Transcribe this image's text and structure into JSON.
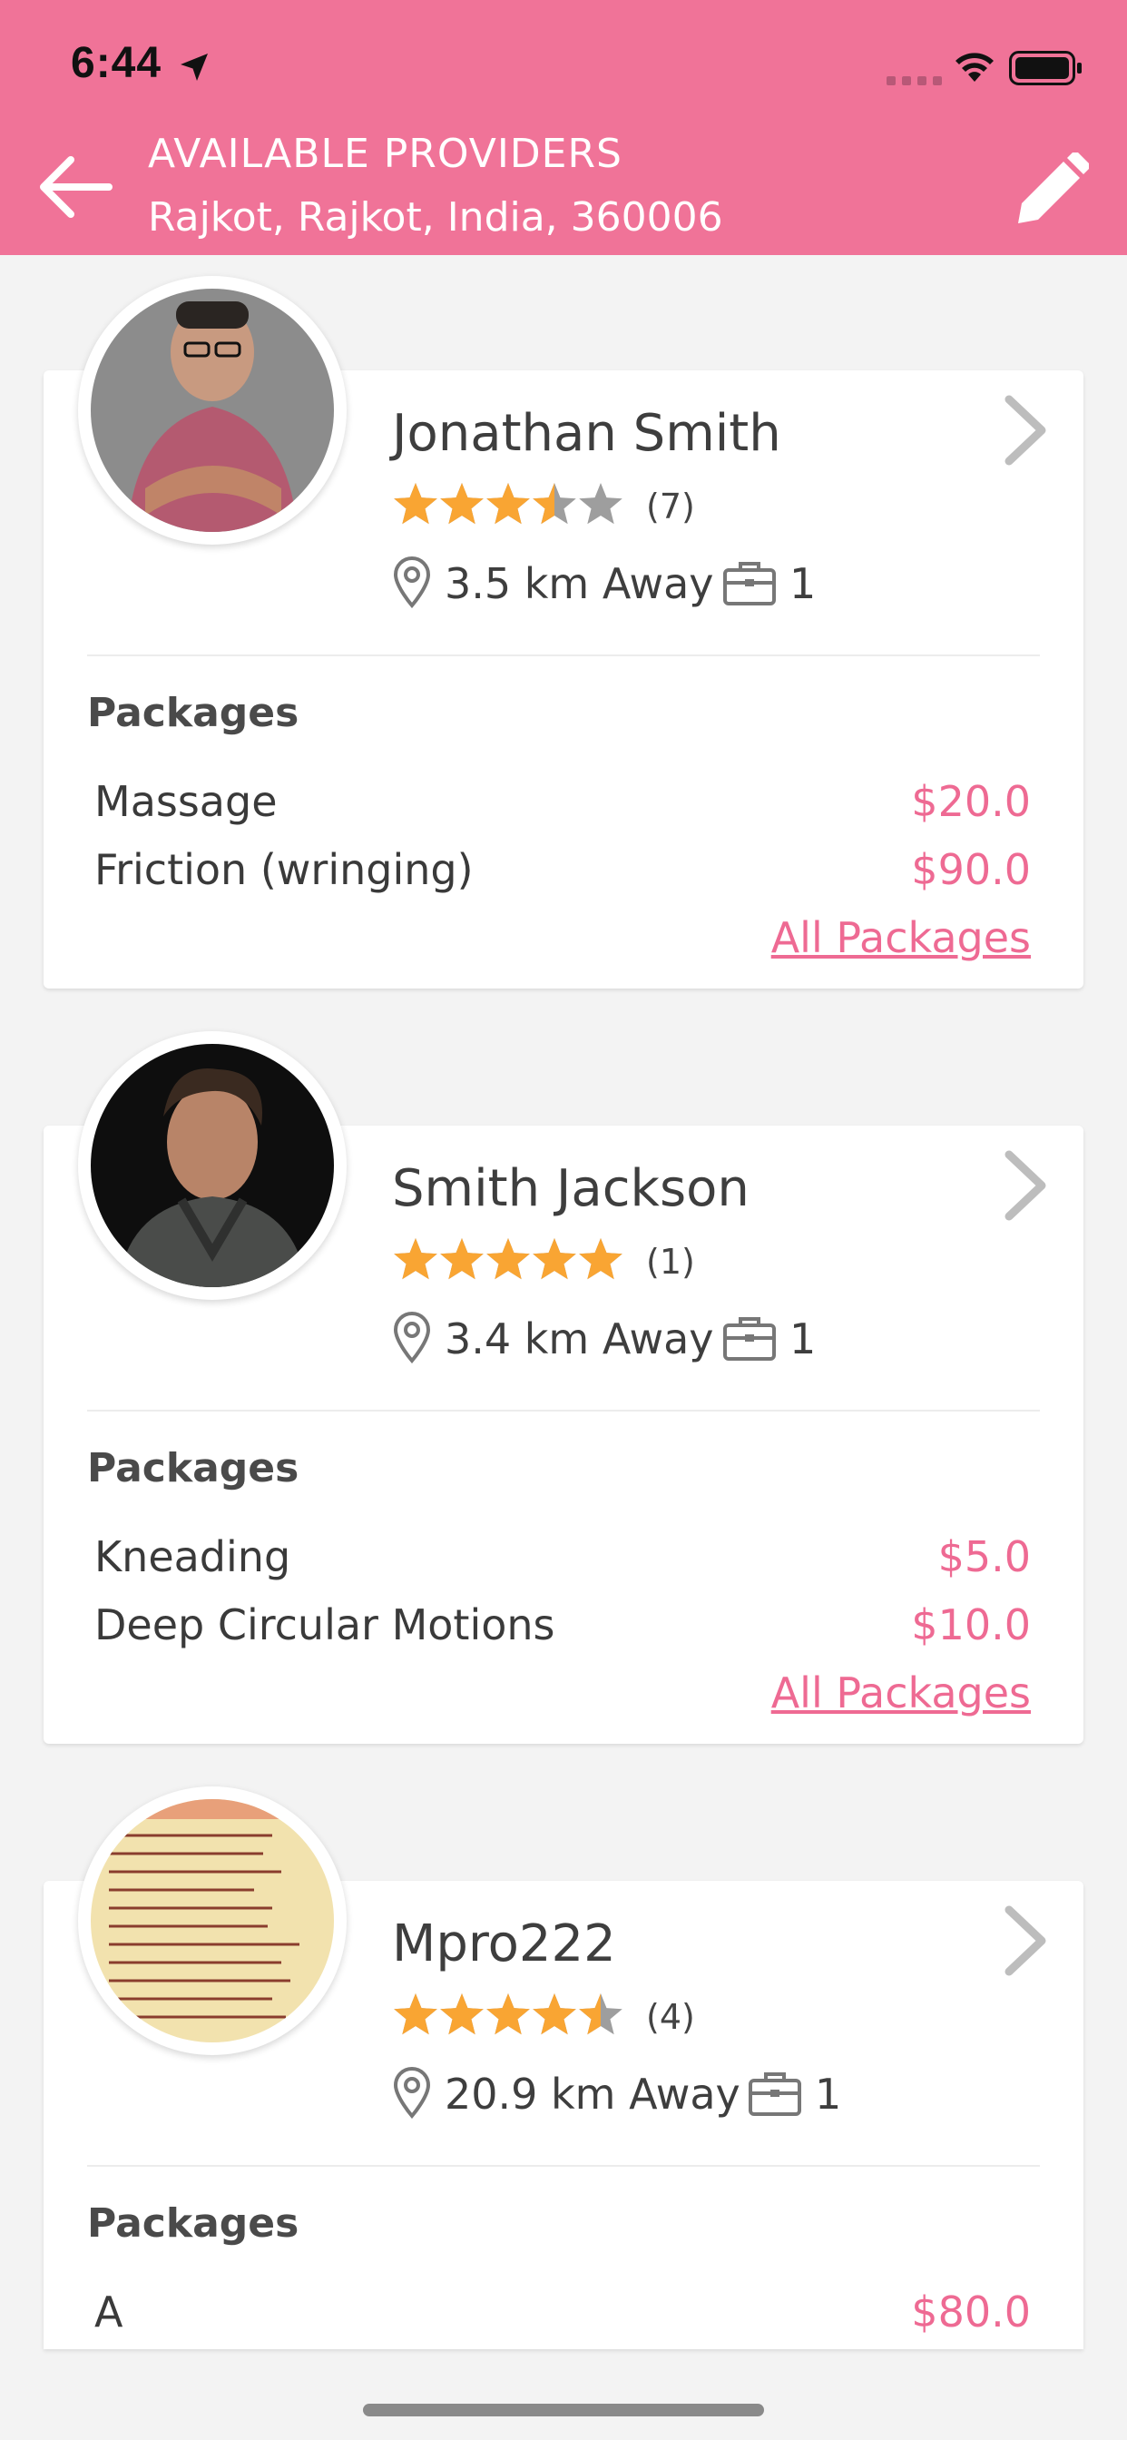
{
  "status_bar": {
    "time": "6:44"
  },
  "header": {
    "title": "AVAILABLE PROVIDERS",
    "subtitle": "Rajkot, Rajkot, India, 360006",
    "accent_color": "#f07398"
  },
  "providers": [
    {
      "name": "Jonathan Smith",
      "rating": 3.5,
      "rating_count": "(7)",
      "distance": "3.5 km Away",
      "jobs": "1",
      "packages_label": "Packages",
      "packages": [
        {
          "name": "Massage",
          "price": "$20.0"
        },
        {
          "name": "Friction (wringing)",
          "price": "$90.0"
        }
      ],
      "all_packages_label": "All Packages"
    },
    {
      "name": "Smith Jackson",
      "rating": 5,
      "rating_count": "(1)",
      "distance": "3.4 km Away",
      "jobs": "1",
      "packages_label": "Packages",
      "packages": [
        {
          "name": "Kneading",
          "price": "$5.0"
        },
        {
          "name": "Deep Circular Motions",
          "price": "$10.0"
        }
      ],
      "all_packages_label": "All Packages"
    },
    {
      "name": "Mpro222",
      "rating": 4.5,
      "rating_count": "(4)",
      "distance": "20.9 km Away",
      "jobs": "1",
      "packages_label": "Packages",
      "packages": [
        {
          "name": "A",
          "price": "$80.0"
        }
      ]
    }
  ],
  "colors": {
    "star_filled": "#f9a533",
    "star_empty": "#9e9e9e",
    "price": "#ee6a93",
    "background": "#f3f3f3"
  },
  "icons": [
    "location-arrow-icon",
    "signal-icon",
    "wifi-icon",
    "battery-icon",
    "back-arrow-icon",
    "edit-pencil-icon",
    "chevron-right-icon",
    "star-icon",
    "map-pin-icon",
    "briefcase-icon"
  ]
}
